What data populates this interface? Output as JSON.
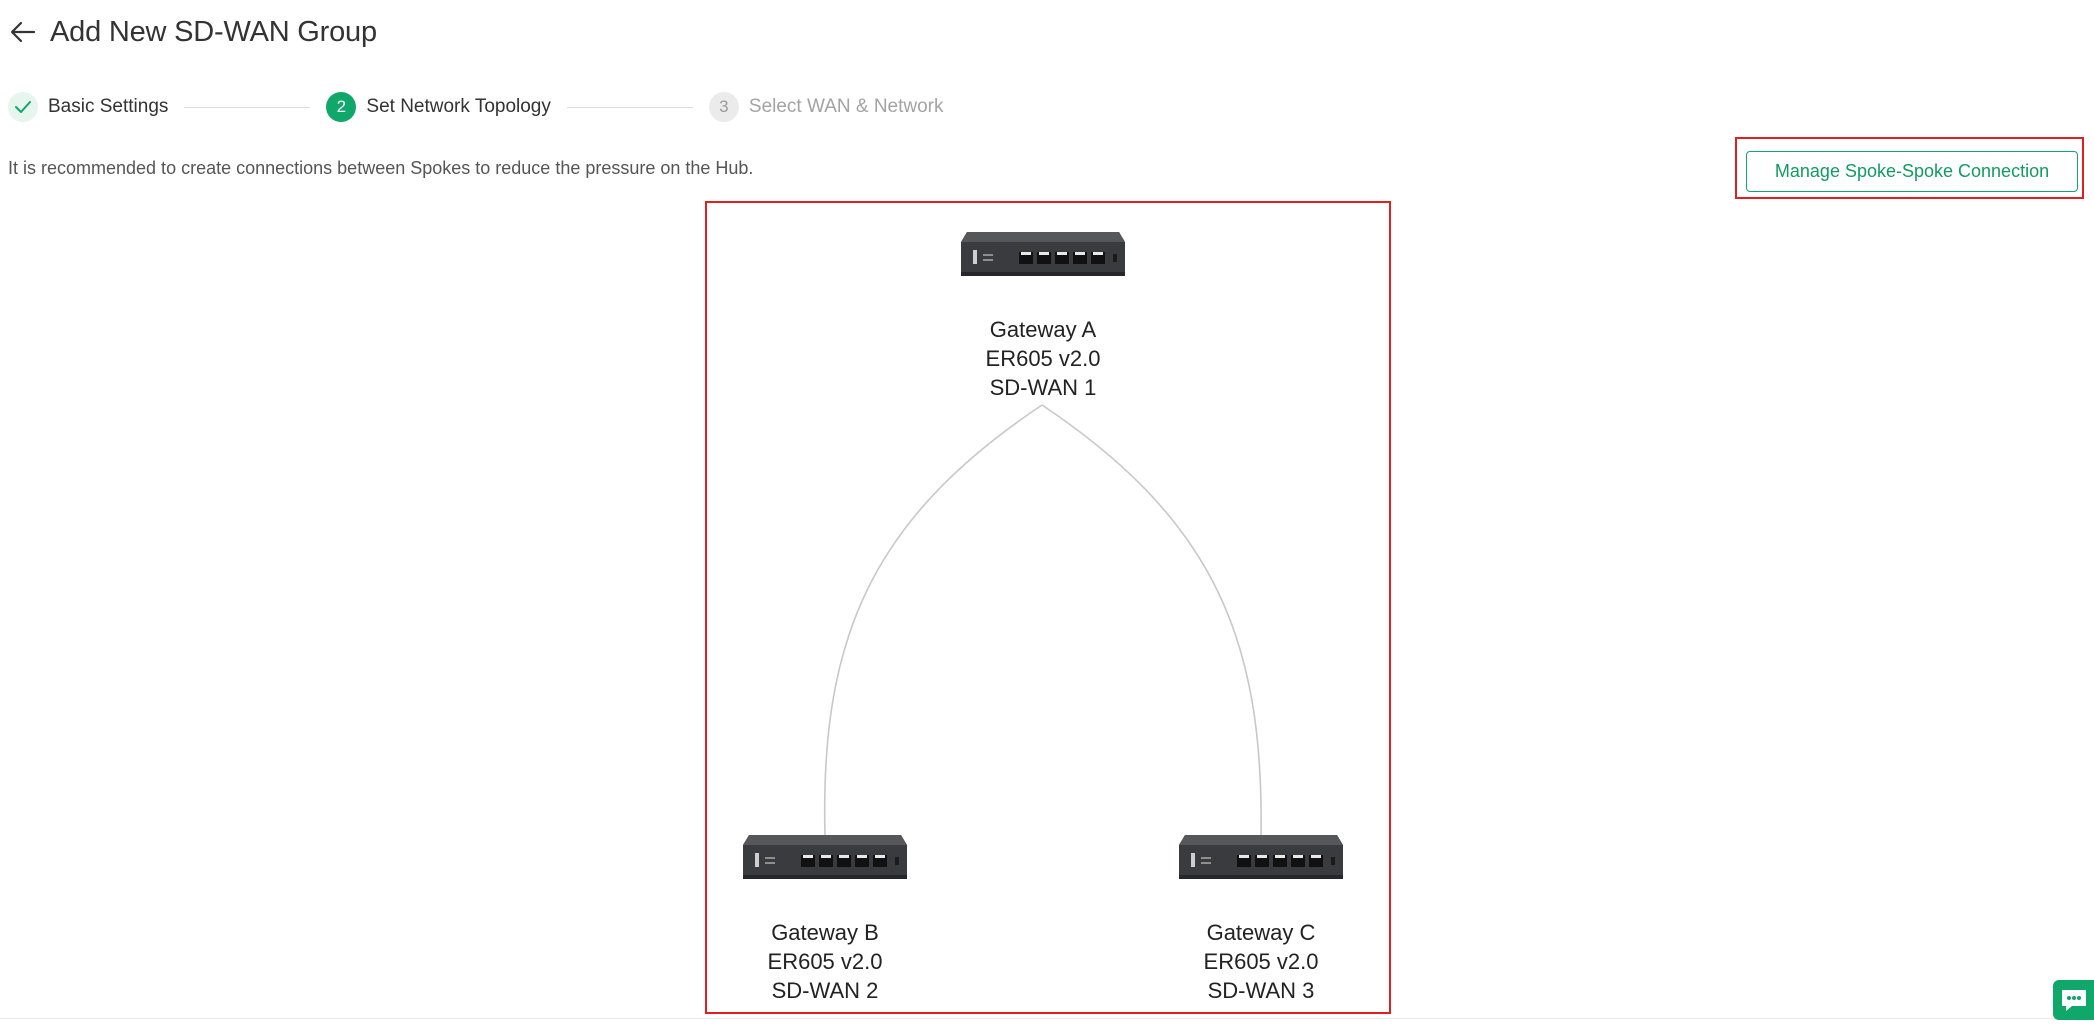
{
  "header": {
    "back_icon": "arrow-left-icon",
    "title": "Add New SD-WAN Group"
  },
  "stepper": {
    "steps": [
      {
        "number": "✓",
        "label": "Basic Settings",
        "state": "done"
      },
      {
        "number": "2",
        "label": "Set Network Topology",
        "state": "active"
      },
      {
        "number": "3",
        "label": "Select WAN & Network",
        "state": "pending"
      }
    ]
  },
  "notice": "It is recommended to create connections between Spokes to reduce the pressure on the Hub.",
  "manage_button": "Manage Spoke-Spoke Connection",
  "topology": {
    "nodes": [
      {
        "name": "Gateway A",
        "model": "ER605 v2.0",
        "group": "SD-WAN 1"
      },
      {
        "name": "Gateway B",
        "model": "ER605 v2.0",
        "group": "SD-WAN 2"
      },
      {
        "name": "Gateway C",
        "model": "ER605 v2.0",
        "group": "SD-WAN 3"
      }
    ]
  },
  "colors": {
    "accent": "#10a76b",
    "highlight": "#e02020",
    "link": "#c8c8c8"
  },
  "chat_widget_icon": "chat-bubble-icon"
}
